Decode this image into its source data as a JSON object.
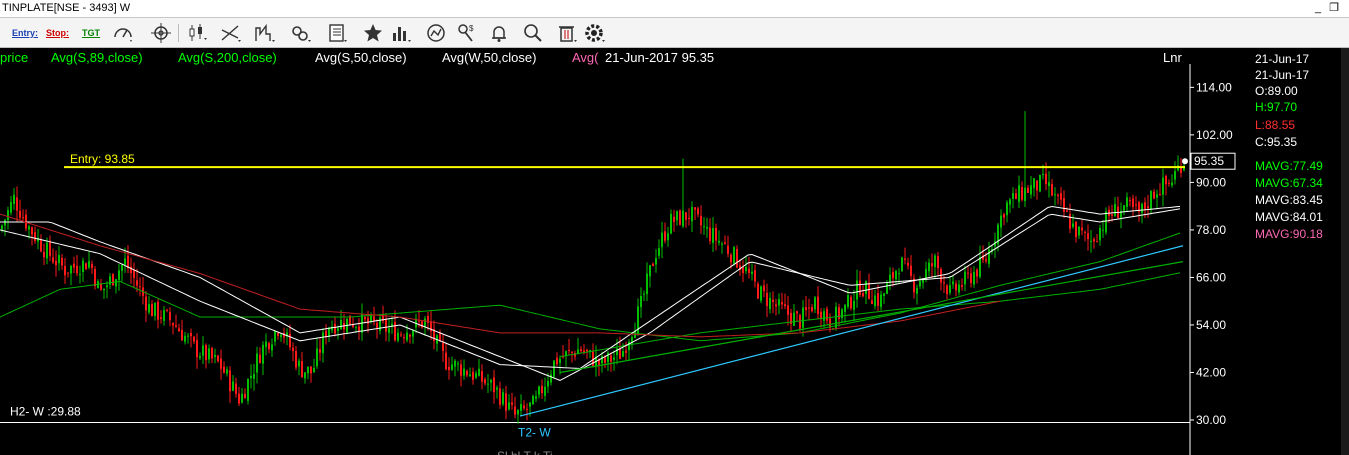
{
  "window": {
    "title": "TINPLATE[NSE - 3493] W"
  },
  "toolbar": {
    "entry_label": "Entry:",
    "stop_label": "Stop:",
    "target_label": "TGT"
  },
  "legend": {
    "items": [
      {
        "text": "price",
        "color": "#00ff00"
      },
      {
        "text": "Avg(S,89,close)",
        "color": "#00ff00"
      },
      {
        "text": "Avg(S,200,close)",
        "color": "#00ff00"
      },
      {
        "text": "Avg(S,50,close)",
        "color": "#ffffff"
      },
      {
        "text": "Avg(W,50,close)",
        "color": "#ffffff"
      },
      {
        "text": "Avg(",
        "color": "#ff69b4"
      },
      {
        "text": "21-Jun-2017 95.35",
        "color": "#ffffff"
      }
    ],
    "scale_label": "Lnr"
  },
  "info_panel": {
    "date_1": "21-Jun-17",
    "date_2": "21-Jun-17",
    "open": "O:89.00",
    "high": "H:97.70",
    "low": "L:88.55",
    "close": "C:95.35",
    "mavgs": [
      {
        "text": "MAVG:77.49",
        "color": "#00ff00"
      },
      {
        "text": "MAVG:67.34",
        "color": "#00ff00"
      },
      {
        "text": "MAVG:83.45",
        "color": "#ffffff"
      },
      {
        "text": "MAVG:84.01",
        "color": "#ffffff"
      },
      {
        "text": "MAVG:90.18",
        "color": "#ff69b4"
      }
    ],
    "colors": {
      "high": "#00ff00",
      "low": "#ff3030",
      "neutral": "#ffffff"
    }
  },
  "annotations": {
    "entry": "Entry: 93.85",
    "h2": "H2- W :29.88",
    "t2": "T2- W",
    "last_price": "95.35",
    "footer_partial": "Sl  bl   T  k Ti"
  },
  "chart_data": {
    "type": "candlestick",
    "timeframe": "weekly",
    "ylim": [
      26,
      122
    ],
    "yticks": [
      30,
      42,
      54,
      66,
      78,
      90,
      102,
      114
    ],
    "ytick_labels": [
      "30.00",
      "42.00",
      "54.00",
      "66.00",
      "78.00",
      "90.00",
      "102.00",
      "114.00"
    ],
    "last_close": 95.35,
    "entry_level": 93.85,
    "support_level": 29.88,
    "close_series_anchors": [
      [
        0,
        78
      ],
      [
        14,
        86
      ],
      [
        28,
        79
      ],
      [
        45,
        73
      ],
      [
        65,
        68
      ],
      [
        90,
        70
      ],
      [
        100,
        62
      ],
      [
        125,
        70
      ],
      [
        150,
        58
      ],
      [
        172,
        55
      ],
      [
        195,
        48
      ],
      [
        220,
        44
      ],
      [
        240,
        35
      ],
      [
        262,
        48
      ],
      [
        280,
        54
      ],
      [
        300,
        43
      ],
      [
        312,
        42
      ],
      [
        328,
        54
      ],
      [
        350,
        55
      ],
      [
        375,
        54
      ],
      [
        400,
        52
      ],
      [
        425,
        55
      ],
      [
        445,
        45
      ],
      [
        470,
        42
      ],
      [
        495,
        38
      ],
      [
        515,
        31
      ],
      [
        535,
        34
      ],
      [
        555,
        45
      ],
      [
        580,
        48
      ],
      [
        600,
        44
      ],
      [
        622,
        47
      ],
      [
        640,
        58
      ],
      [
        655,
        72
      ],
      [
        670,
        80
      ],
      [
        690,
        82
      ],
      [
        705,
        78
      ],
      [
        725,
        74
      ],
      [
        745,
        68
      ],
      [
        760,
        62
      ],
      [
        780,
        58
      ],
      [
        800,
        55
      ],
      [
        815,
        60
      ],
      [
        830,
        55
      ],
      [
        845,
        58
      ],
      [
        860,
        64
      ],
      [
        880,
        60
      ],
      [
        900,
        70
      ],
      [
        915,
        64
      ],
      [
        935,
        70
      ],
      [
        950,
        62
      ],
      [
        965,
        65
      ],
      [
        985,
        70
      ],
      [
        1005,
        84
      ],
      [
        1025,
        88
      ],
      [
        1045,
        90
      ],
      [
        1060,
        84
      ],
      [
        1075,
        78
      ],
      [
        1090,
        75
      ],
      [
        1110,
        82
      ],
      [
        1125,
        84
      ],
      [
        1140,
        82
      ],
      [
        1155,
        88
      ],
      [
        1170,
        90
      ],
      [
        1182,
        95.35
      ]
    ],
    "spikes": [
      {
        "x": 1025,
        "value": 108
      },
      {
        "x": 683,
        "value": 96
      }
    ],
    "moving_averages": [
      {
        "name": "Avg(S,89,close)",
        "color": "#00b000",
        "anchors": [
          [
            0,
            56
          ],
          [
            60,
            63
          ],
          [
            120,
            65
          ],
          [
            200,
            56
          ],
          [
            350,
            56
          ],
          [
            500,
            59
          ],
          [
            600,
            53
          ],
          [
            700,
            50
          ],
          [
            800,
            52
          ],
          [
            900,
            57
          ],
          [
            1000,
            64
          ],
          [
            1100,
            70
          ],
          [
            1183,
            77.49
          ]
        ]
      },
      {
        "name": "Avg(S,200,close)",
        "color": "#00b000",
        "anchors": [
          [
            560,
            46
          ],
          [
            700,
            52
          ],
          [
            800,
            55
          ],
          [
            900,
            58
          ],
          [
            1000,
            60
          ],
          [
            1100,
            63
          ],
          [
            1183,
            67.34
          ]
        ]
      },
      {
        "name": "Avg(S,50,close)",
        "color": "#ffffff",
        "anchors": [
          [
            0,
            80
          ],
          [
            50,
            80
          ],
          [
            100,
            75
          ],
          [
            200,
            66
          ],
          [
            300,
            52
          ],
          [
            400,
            56
          ],
          [
            500,
            46
          ],
          [
            560,
            40
          ],
          [
            650,
            52
          ],
          [
            750,
            70
          ],
          [
            850,
            64
          ],
          [
            950,
            66
          ],
          [
            1050,
            82
          ],
          [
            1100,
            80
          ],
          [
            1183,
            83.45
          ]
        ]
      },
      {
        "name": "Avg(W,50,close)",
        "color": "#ffffff",
        "anchors": [
          [
            0,
            78
          ],
          [
            100,
            72
          ],
          [
            200,
            60
          ],
          [
            300,
            50
          ],
          [
            400,
            54
          ],
          [
            500,
            44
          ],
          [
            580,
            43
          ],
          [
            650,
            55
          ],
          [
            750,
            72
          ],
          [
            850,
            62
          ],
          [
            950,
            67
          ],
          [
            1050,
            84
          ],
          [
            1100,
            82
          ],
          [
            1183,
            84.01
          ]
        ]
      },
      {
        "name": "Avg(",
        "color": "#c02020",
        "anchors": [
          [
            0,
            82
          ],
          [
            100,
            74
          ],
          [
            200,
            67
          ],
          [
            300,
            58
          ],
          [
            400,
            56
          ],
          [
            500,
            52
          ],
          [
            600,
            52
          ],
          [
            700,
            51
          ],
          [
            800,
            52
          ],
          [
            900,
            55
          ],
          [
            1000,
            60
          ]
        ]
      }
    ],
    "trendlines": [
      {
        "color": "#2fc8ff",
        "from": [
          520,
          31
        ],
        "to": [
          1183,
          74
        ]
      },
      {
        "color": "#00b000",
        "from": [
          560,
          42
        ],
        "to": [
          1183,
          70
        ]
      }
    ]
  }
}
